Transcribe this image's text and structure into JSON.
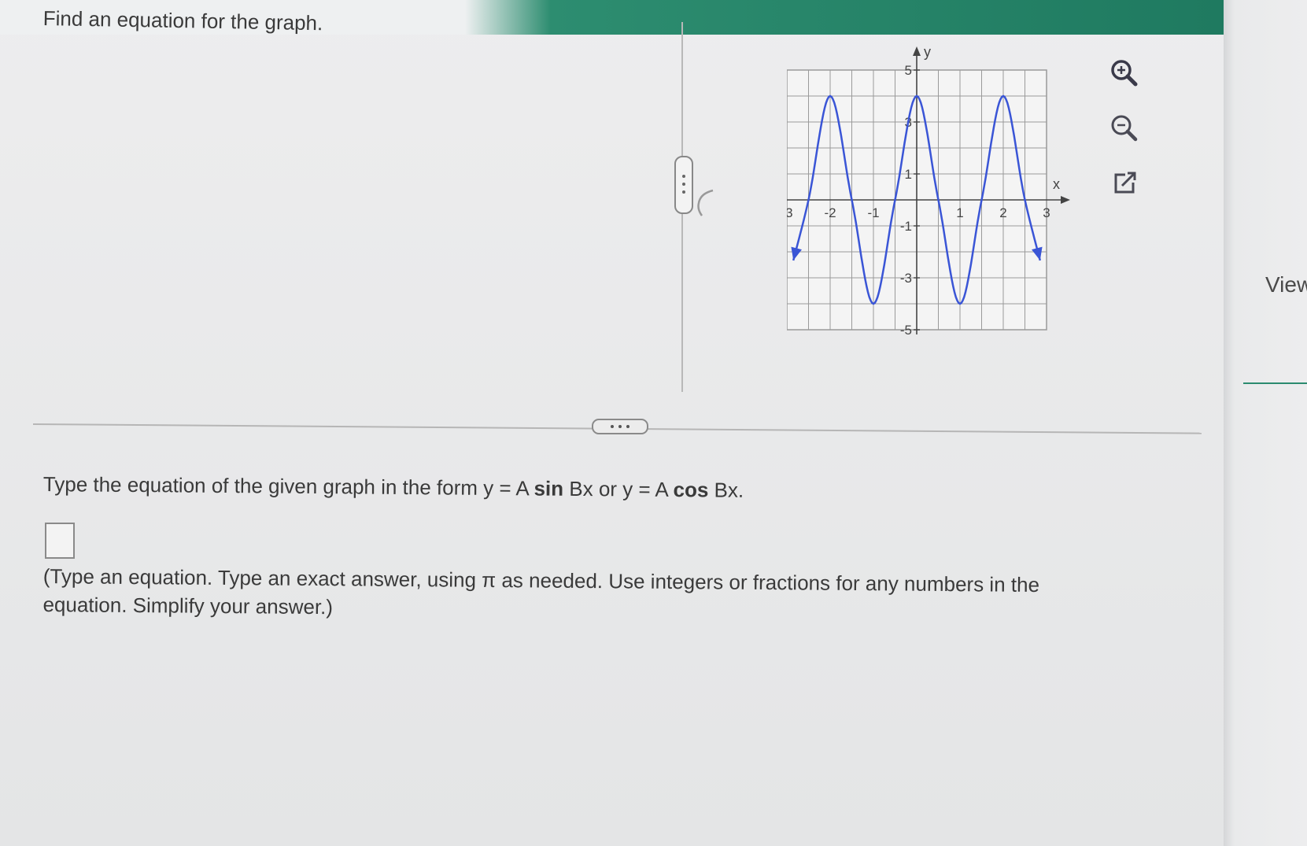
{
  "question": {
    "title": "Find an equation for the graph."
  },
  "graph": {
    "x_axis_label": "x",
    "y_axis_label": "y",
    "x_tick_labels": [
      "-3",
      "-2",
      "-1",
      "1",
      "2",
      "3"
    ],
    "y_tick_labels": [
      "5",
      "3",
      "1",
      "-1",
      "-3",
      "-5"
    ],
    "curve_color": "#3a55d6",
    "grid_color": "#9a9a9a"
  },
  "chart_data": {
    "type": "line",
    "xlim": [
      -3,
      3
    ],
    "ylim": [
      -5,
      5
    ],
    "grid": true,
    "series": [
      {
        "x": [
          -2.85,
          -2.5,
          -2,
          -1.5,
          -1,
          -0.5,
          0,
          0.5,
          1,
          1.5,
          2,
          2.5,
          2.85
        ],
        "values": [
          -2.33,
          0,
          4,
          0,
          -4,
          0,
          4,
          0,
          -4,
          0,
          4,
          0,
          -2.33
        ]
      }
    ]
  },
  "tools": {
    "zoom_in": "zoom-in-icon",
    "zoom_out": "zoom-out-icon",
    "popout": "external-link-icon"
  },
  "answer": {
    "instruction_prefix": "Type the equation of the given graph in the form y = A ",
    "sin": "sin",
    "middle": " Bx or y = A ",
    "cos": "cos",
    "suffix": " Bx.",
    "value": "",
    "hint": "(Type an equation. Type an exact answer, using π as needed. Use integers or fractions for any numbers in the equation. Simplify your answer.)"
  },
  "sidebar": {
    "view_label": "View"
  }
}
